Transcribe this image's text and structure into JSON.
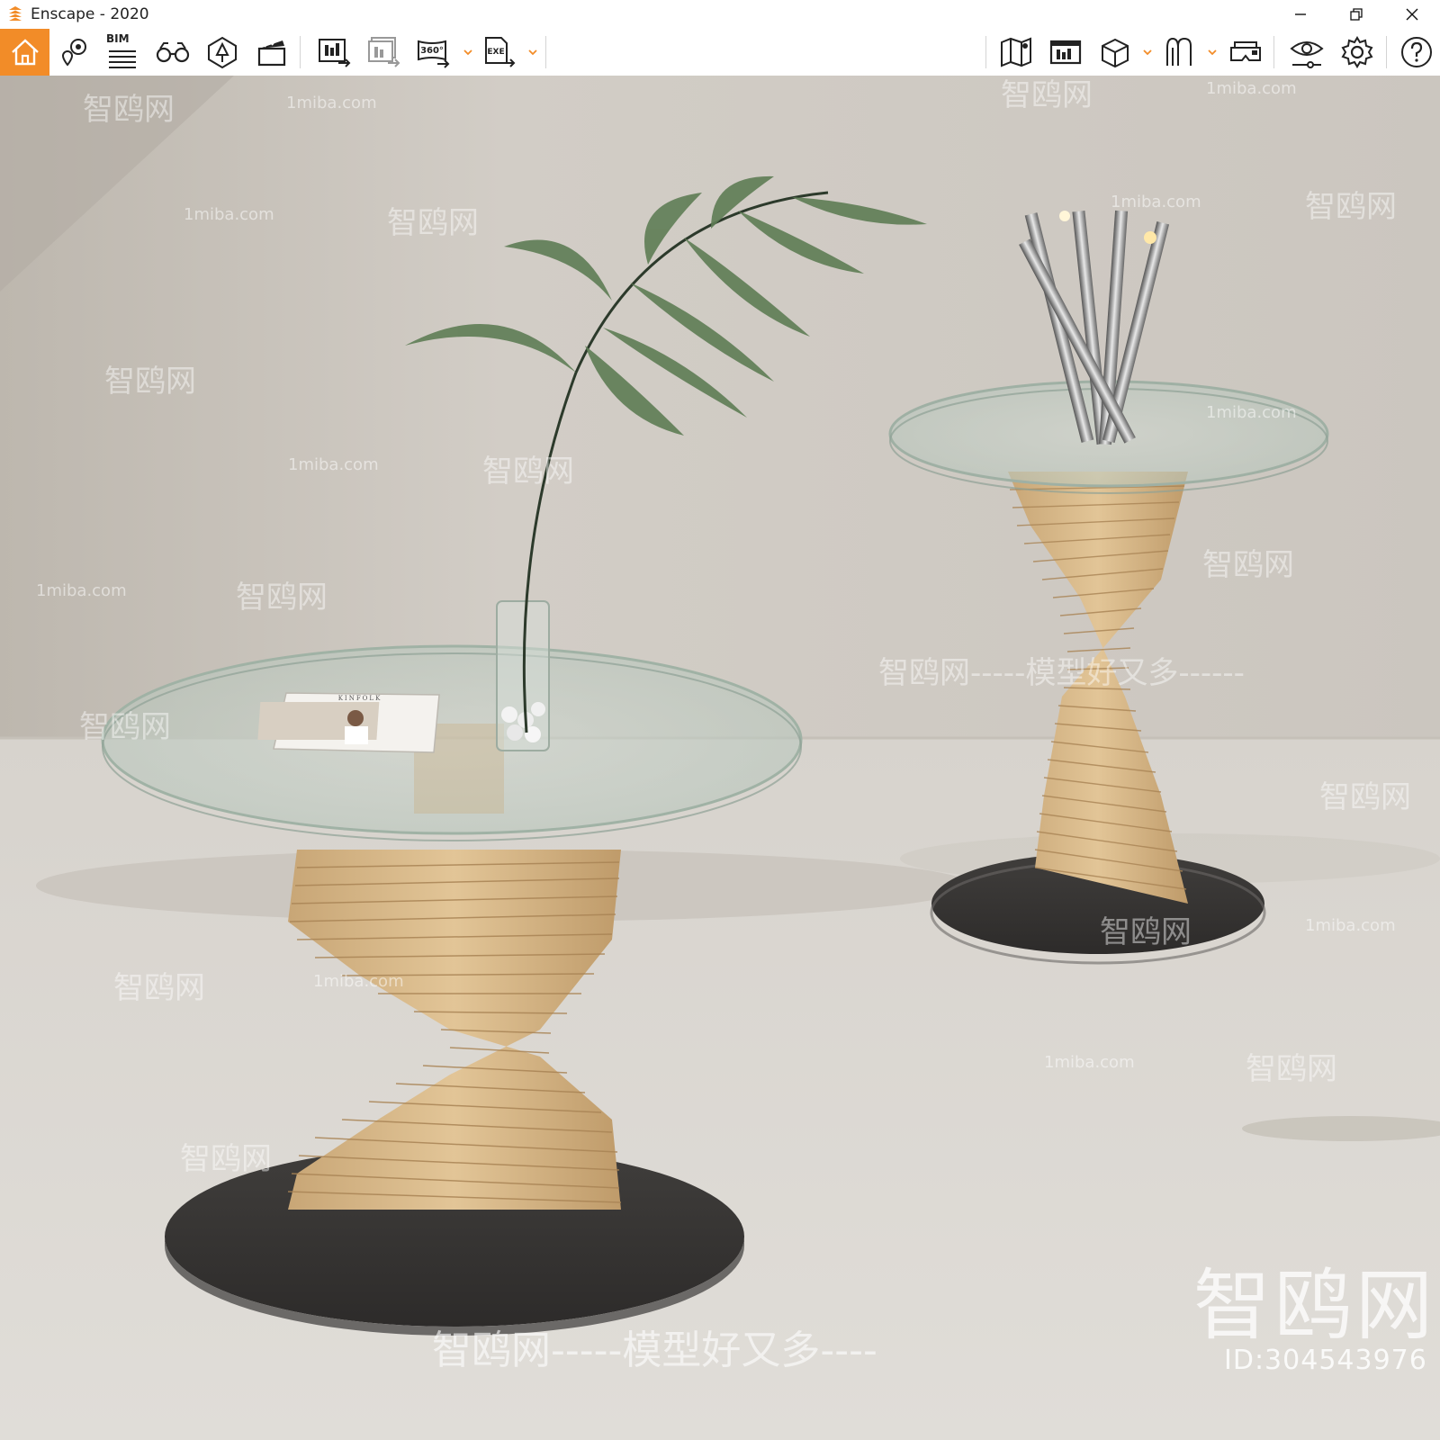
{
  "window": {
    "title": "Enscape - 2020"
  },
  "toolbar": {
    "bim_label": "BIM",
    "panorama_label": "360°",
    "exe_label": "EXE"
  },
  "icons": {
    "home": "home-icon",
    "views": "map-pin-icon",
    "bim": "bim-list-icon",
    "walk": "binoculars-icon",
    "assets": "asset-library-icon",
    "video": "clapperboard-icon",
    "screenshot": "render-screenshot-icon",
    "batch": "batch-render-icon",
    "pano": "panorama-360-icon",
    "exe": "export-exe-icon",
    "map": "map-icon",
    "info": "info-panel-icon",
    "box": "cube-icon",
    "plants": "outdoor-icon",
    "vr": "vr-headset-icon",
    "visual": "eye-settings-icon",
    "settings": "gear-icon",
    "help": "help-icon"
  },
  "colors": {
    "accent": "#f28c28",
    "wall": "#cfcac3",
    "floor": "#dcd8d2",
    "wood": "#d9b78a",
    "base": "#3a3836"
  },
  "watermarks": {
    "site": "1miba.com",
    "brand": "智鸥网",
    "slogan": "智鸥网-----模型好又多----",
    "slogan_right": "智鸥网-----模型好又多------",
    "big_brand": "智鸥网",
    "id": "ID:304543976"
  },
  "magazine": {
    "title": "KINFOLK"
  }
}
